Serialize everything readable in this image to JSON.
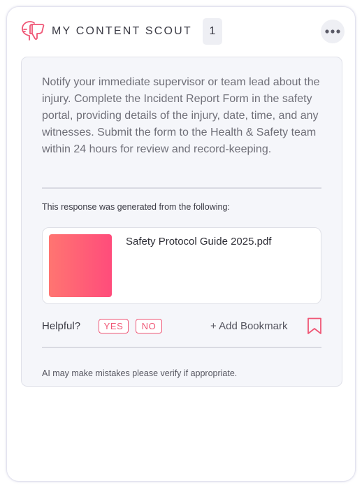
{
  "header": {
    "title": "MY CONTENT SCOUT",
    "count": "1",
    "logo_icon": "thumbs-down-head-icon",
    "more_icon": "more-horizontal-icon"
  },
  "response": {
    "answer": "Notify your immediate supervisor or team lead about the injury. Complete the Incident Report Form in the safety portal, providing details of the injury, date, time, and any witnesses. Submit the form to the Health & Safety team within 24 hours for review and record-keeping.",
    "generated_from": "This response was generated from the following:",
    "sources": [
      {
        "name": "Safety Protocol Guide 2025.pdf"
      }
    ]
  },
  "feedback": {
    "helpful_label": "Helpful?",
    "yes_label": "YES",
    "no_label": "NO",
    "add_bookmark_label": "+ Add Bookmark",
    "bookmark_icon": "bookmark-icon"
  },
  "disclaimer": "AI may make mistakes please verify if appropriate.",
  "colors": {
    "accent": "#ef5675",
    "thumbnail_gradient": [
      "#ff7571",
      "#ff4c7b"
    ],
    "panel_bg": "#f5f6fa"
  }
}
